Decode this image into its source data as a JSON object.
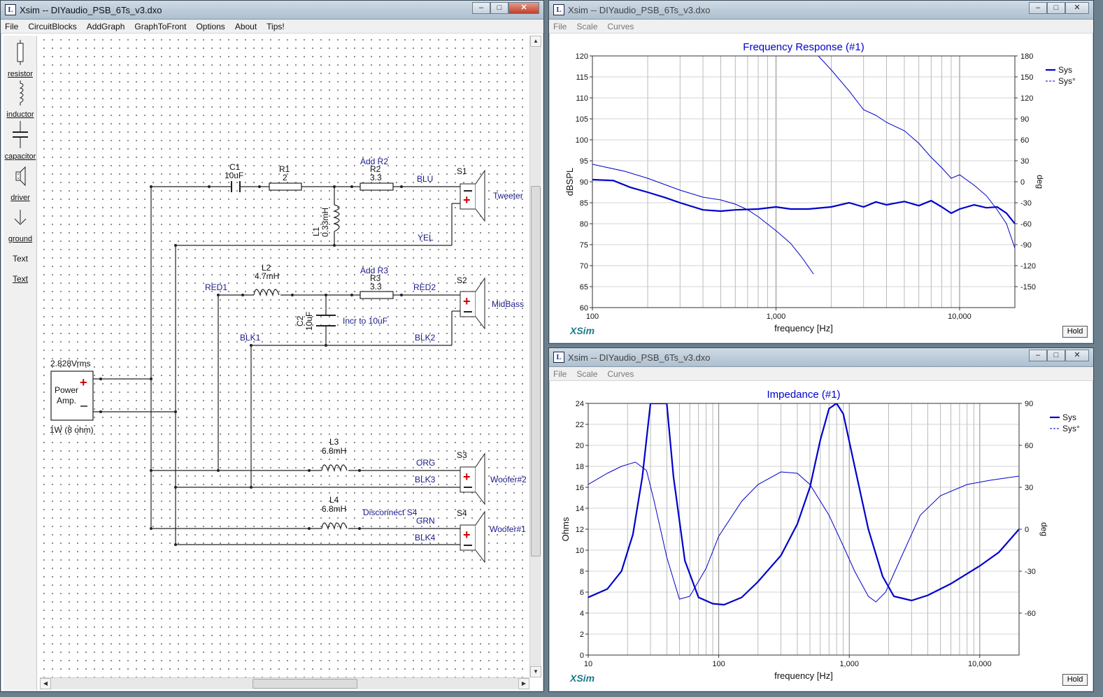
{
  "left_window": {
    "title": "Xsim -- DIYaudio_PSB_6Ts_v3.dxo",
    "menu": [
      "File",
      "CircuitBlocks",
      "AddGraph",
      "GraphToFront",
      "Options",
      "About",
      "Tips!"
    ],
    "tools": [
      {
        "label": "resistor",
        "icon": "resistor-icon"
      },
      {
        "label": "inductor",
        "icon": "inductor-icon"
      },
      {
        "label": "capacitor",
        "icon": "capacitor-icon"
      },
      {
        "label": "driver",
        "icon": "driver-icon"
      },
      {
        "label": "ground",
        "icon": "ground-icon"
      },
      {
        "label": "Text",
        "icon": "text-tool"
      },
      {
        "label": "Text",
        "icon": "text-tool"
      }
    ]
  },
  "schematic": {
    "c1": {
      "name": "C1",
      "value": "10uF"
    },
    "r1": {
      "name": "R1",
      "value": "2"
    },
    "r2": {
      "note": "Add R2",
      "name": "R2",
      "value": "3.3"
    },
    "l1": {
      "name": "L1",
      "value": "0.33mH"
    },
    "blu": "BLU",
    "yel": "YEL",
    "s1": {
      "name": "S1",
      "label": "Tweeter"
    },
    "l2": {
      "name": "L2",
      "value": "4.7mH"
    },
    "r3": {
      "note": "Add R3",
      "name": "R3",
      "value": "3.3"
    },
    "red1": "RED1",
    "red2": "RED2",
    "c2": {
      "name": "C2",
      "value": "10uF",
      "note": "Incr to 10uF"
    },
    "blk1": "BLK1",
    "blk2": "BLK2",
    "s2": {
      "name": "S2",
      "label": "MidBass"
    },
    "amp": {
      "voltage": "2.828Vrms",
      "line1": "Power",
      "line2": "Amp.",
      "power": "1W (8 ohm)"
    },
    "l3": {
      "name": "L3",
      "value": "6.8mH"
    },
    "org": "ORG",
    "blk3": "BLK3",
    "s3": {
      "name": "S3",
      "label": "Woofer#2"
    },
    "l4": {
      "name": "L4",
      "value": "6.8mH",
      "note": "Disconnect S4"
    },
    "grn": "GRN",
    "blk4": "BLK4",
    "s4": {
      "name": "S4",
      "label": "Woofer#1"
    }
  },
  "fr_window": {
    "title": "Xsim -- DIYaudio_PSB_6Ts_v3.dxo",
    "menu": [
      "File",
      "Scale",
      "Curves"
    ],
    "hold": "Hold",
    "brand": "XSim"
  },
  "imp_window": {
    "title": "Xsim -- DIYaudio_PSB_6Ts_v3.dxo",
    "menu": [
      "File",
      "Scale",
      "Curves"
    ],
    "hold": "Hold",
    "brand": "XSim"
  },
  "chart_data": [
    {
      "type": "line",
      "title": "Frequency Response (#1)",
      "xlabel": "frequency [Hz]",
      "ylabel": "dBSPL",
      "y2label": "deg",
      "xscale": "log",
      "xlim": [
        100,
        20000
      ],
      "ylim": [
        60,
        120
      ],
      "y2lim": [
        -180,
        180
      ],
      "xticks": [
        {
          "v": 100,
          "t": "100"
        },
        {
          "v": 1000,
          "t": "1,000"
        },
        {
          "v": 10000,
          "t": "10,000"
        }
      ],
      "yticks": [
        60,
        65,
        70,
        75,
        80,
        85,
        90,
        95,
        100,
        105,
        110,
        115,
        120
      ],
      "y2ticks": [
        -150,
        -120,
        -90,
        -60,
        -30,
        0,
        30,
        60,
        90,
        120,
        150,
        180
      ],
      "legend": [
        "Sys",
        "Sys°"
      ],
      "legend_position": "top-right",
      "color": "#0000cc",
      "series": [
        {
          "name": "Sys",
          "axis": "left",
          "style": "solid-thick",
          "x": [
            100,
            130,
            160,
            200,
            250,
            300,
            400,
            500,
            600,
            800,
            1000,
            1200,
            1500,
            2000,
            2500,
            3000,
            3500,
            4000,
            5000,
            6000,
            7000,
            8000,
            9000,
            10000,
            12000,
            14000,
            16000,
            18000,
            20000
          ],
          "y": [
            90.5,
            90.3,
            88.7,
            87.5,
            86.2,
            85,
            83.3,
            83,
            83.3,
            83.5,
            84,
            83.5,
            83.5,
            84,
            85,
            84,
            85.2,
            84.5,
            85.3,
            84.3,
            85.5,
            84,
            82.5,
            83.5,
            84.5,
            83.8,
            84,
            82.5,
            80
          ]
        },
        {
          "name": "Sys°",
          "axis": "right",
          "style": "solid-thin",
          "x": [
            100,
            150,
            200,
            300,
            400,
            500,
            600,
            700,
            800,
            1000,
            1200,
            1400,
            1600,
            1700,
            2000,
            2500,
            3000,
            3500,
            4000,
            5000,
            6000,
            7000,
            8000,
            9000,
            10000,
            12000,
            14000,
            16000,
            18000,
            20000
          ],
          "y": [
            25,
            15,
            5,
            -12,
            -22,
            -26,
            -32,
            -40,
            -50,
            -70,
            -88,
            -110,
            -132,
            180,
            160,
            130,
            103,
            95,
            85,
            73,
            55,
            35,
            20,
            5,
            10,
            -5,
            -20,
            -40,
            -60,
            -95
          ]
        }
      ]
    },
    {
      "type": "line",
      "title": "Impedance (#1)",
      "xlabel": "frequency [Hz]",
      "ylabel": "Ohms",
      "y2label": "deg",
      "xscale": "log",
      "xlim": [
        10,
        20000
      ],
      "ylim": [
        0,
        24
      ],
      "y2lim": [
        -90,
        90
      ],
      "xticks": [
        {
          "v": 10,
          "t": "10"
        },
        {
          "v": 100,
          "t": "100"
        },
        {
          "v": 1000,
          "t": "1,000"
        },
        {
          "v": 10000,
          "t": "10,000"
        }
      ],
      "yticks": [
        0,
        2,
        4,
        6,
        8,
        10,
        12,
        14,
        16,
        18,
        20,
        22,
        24
      ],
      "y2ticks": [
        -60,
        -30,
        0,
        30,
        60,
        90
      ],
      "legend": [
        "Sys",
        "Sys°"
      ],
      "legend_position": "top-right",
      "color": "#0000cc",
      "series": [
        {
          "name": "Sys",
          "axis": "left",
          "style": "solid-thick",
          "x": [
            10,
            14,
            18,
            22,
            26,
            30,
            40,
            45,
            55,
            70,
            90,
            110,
            150,
            200,
            300,
            400,
            500,
            600,
            700,
            800,
            900,
            1100,
            1400,
            1800,
            2200,
            3000,
            4000,
            6000,
            10000,
            14000,
            20000
          ],
          "y": [
            5.5,
            6.3,
            8,
            11.5,
            17,
            24,
            24,
            17,
            9,
            5.5,
            4.9,
            4.8,
            5.5,
            7,
            9.5,
            12.5,
            16,
            20.5,
            23.5,
            24,
            23,
            18,
            12,
            7.5,
            5.6,
            5.2,
            5.7,
            6.8,
            8.5,
            9.8,
            12
          ]
        },
        {
          "name": "Sys°",
          "axis": "right",
          "style": "solid-thin",
          "x": [
            10,
            14,
            18,
            23,
            28,
            32,
            40,
            50,
            60,
            80,
            100,
            150,
            200,
            300,
            400,
            500,
            700,
            900,
            1100,
            1400,
            1600,
            1900,
            2500,
            3500,
            5000,
            8000,
            12000,
            20000
          ],
          "y": [
            32,
            40,
            45,
            48,
            42,
            20,
            -20,
            -50,
            -48,
            -28,
            -5,
            20,
            32,
            41,
            40,
            32,
            10,
            -12,
            -30,
            -48,
            -52,
            -45,
            -20,
            10,
            24,
            32,
            35,
            38
          ]
        }
      ]
    }
  ]
}
